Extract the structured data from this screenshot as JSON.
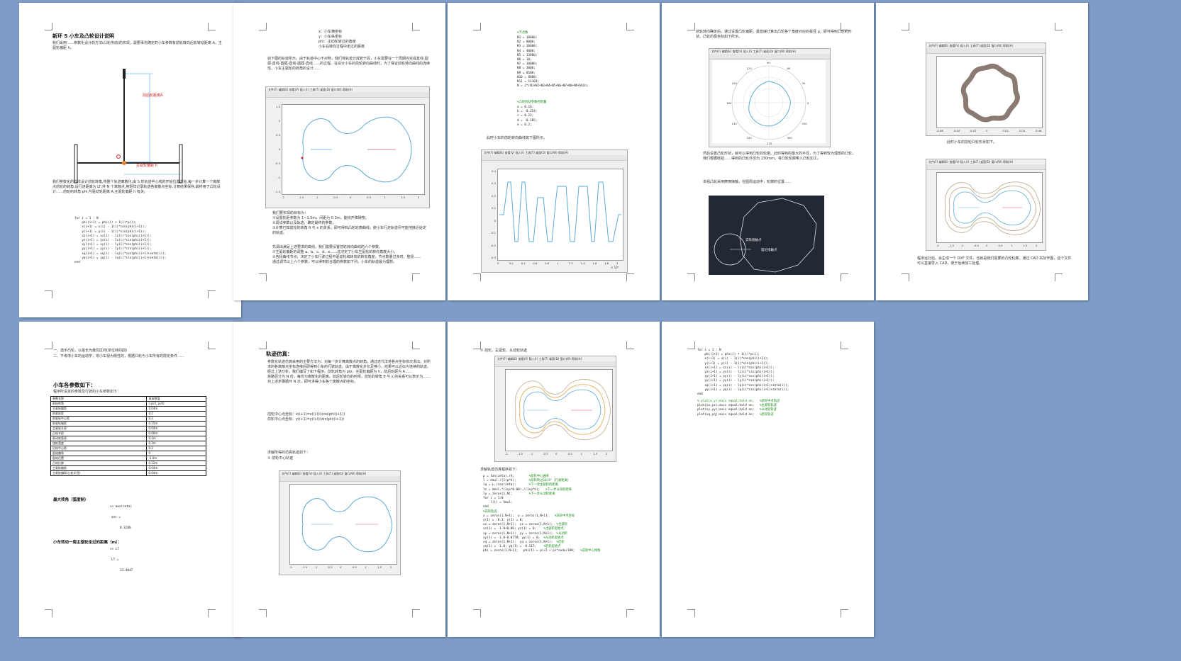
{
  "colors": {
    "background": "#7f9cc8",
    "curve": "#5aa9d6",
    "code_comment": "#1a8a1a"
  },
  "figure_menu": "文件(F)  编辑(E)  查看(V)  插入(I)  工具(T)  桌面(D)  窗口(W)  帮助(H)",
  "page1": {
    "title": "新环 S 小车及凸轮设计说明",
    "intro": "我们采用……参数化设计的方法(凸轮传动)的实现，需要事先确定的小车参数有前轮转向后轮转动距离 A，主驱轮偏距 h。",
    "label_a": "前后轮距离A",
    "label_h": "主驱轮偏距 h",
    "para": "我们参数化的方法设计前轮转角,将整个轨迹离散化,由 S 形轨迹中心线的开始位置开始,每一步计算一个离散点前轮的转角,设行进距离为 LT,共 N 个离散点,用矩阵记录轨迹各离散点坐标,计算结果保存,最终用于凸轮设计……前轮的转角 phi,与驱动轮距离 A,主驱轮偏距 h 有关。",
    "code": [
      "for i = 1 : N",
      "    phi(i+1) = phi(i) + 1(i)*p(i);",
      "    x(i+1) = x(i) - 1(i)*cos(phi(i+1));",
      "    y(i+1) = y(i) - 1(i)*sin(phi(i+1));",
      "    xz(i+1) = xz(i) - lz(i)*cos(phi(i+1));",
      "    yz(i+1) = yz(i) - lz(i)*sin(phi(i+1));",
      "    xy(i+1) = xy(i) - ly(i)*cos(phi(i+1));",
      "    yy(i+1) = yy(i) - ly(i)*sin(phi(i+1));",
      "    xq(i+1) = xq(i) - lq(i)*cos(phi(i+1)+zeta(i));",
      "    yq(i+1) = yq(i) - lq(i)*sin(phi(i+1)+zeta(i));",
      "end"
    ]
  },
  "page2": {
    "list": [
      "x：小车横坐标",
      "y：小车纵坐标",
      "phi：主动轮转过的角度",
      "小车在转向过程中走过的距离"
    ],
    "para1": "如下图的轨迹所示，由于轨迹中心不对称，我们将轨迹分成若干段，小车需要在一个周期内完成直线-圆弧-直线-圆弧-直线-圆弧-直线……的过程。在设计小车的前轮转向曲线时，为了保证前轮转向曲线的连续性，小车主驱轮的转角的设计……",
    "tick_x": [
      "-2",
      "-1.5",
      "-1",
      "-0.5",
      "0",
      "0.5",
      "1",
      "1.5",
      "2"
    ],
    "tick_y": [
      "1.5",
      "1",
      "0.5",
      "0",
      "-0.5",
      "-1",
      "-1.5"
    ],
    "steps": [
      "我们要实现的目标为：",
      "①设置轮距参数为 1~1.5m，间距为 0.3m，能绕开障碍物；",
      "②调试参数以及轨迹，确定最终的参数；",
      "③计算已知前轮的转角 θ 与 x 的关系，即可得到凸轮轮廓曲线，使小车行走轨迹尽可能地接近给定的轨迹。"
    ],
    "para2": "先调出满足上述要求的曲线，我们需要设置前轮转向曲线的六个参数。\n①主驱轮偏距的调整 a、b、c、d、e……这决定了小车主驱轮的转向角度大小。\n②各段曲线节点，决定了小车行驶过程中驱动轮和转向的转向角度，节点数量过多时，整段……\n通过调节以上六个参数，可以得到较合理的参数如下列。小车的轨迹最为理想。"
  },
  "page3": {
    "code_comment1": "%节点数",
    "code_nodes": [
      "N1 = 10000;",
      "N2 = 8000;",
      "N3 = 10000;",
      "N4 = 4000;",
      "N5 = 13000;",
      "N6 = 10;",
      "N7 = 10000;",
      "N8 = 3000;",
      "N9 = 8500;",
      "N10 = 8000;",
      "N11 = 11103;",
      "N = 2*(N1+N2+N3+N4+N5+N6+N7+N8+N9+N10);"
    ],
    "code_comment2": "%凸轮形状参数控制量",
    "code_params": [
      "a = 0.16;",
      "b = -0.254;",
      "c = 0.22;",
      "d = -0.185;",
      "e = 0.2;"
    ],
    "caption": "此时小车的前轮转向曲线如下图所示。",
    "tick_y": [
      "0.4",
      "0.3",
      "0.2",
      "0.1",
      "0",
      "-0.1",
      "-0.2",
      "-0.3"
    ],
    "tick_x": [
      "0",
      "0.2",
      "0.4",
      "0.6",
      "0.8",
      "1",
      "1.2",
      "1.4",
      "1.6",
      "1.8",
      "2"
    ],
    "exp": "× 10⁵"
  },
  "page4": {
    "para1": "前轮转向确定后，通过设置凸轮偏距，最直接计算出凸轮各个角度对应的极径 ρ，即可得到凸轮的形状。凸轮的极坐标如下所示。",
    "polar_labels": [
      "90",
      "60",
      "30",
      "0",
      "330",
      "300",
      "270",
      "240",
      "210",
      "180",
      "150",
      "120"
    ],
    "para2": "然后设置凸轮形状，就可以得到凸轮的轮廓。此时得到的最大的半径，为了得到较为理想的凸轮，我们根据经验……得到的凸轮外径为 130mm，将凸轮轮廓带入凸轮加工。",
    "para3": "本组凸轮采用摩擦接触，在圆周运动中，轮廓的位置……",
    "cad_labels": [
      "实际接触点",
      "理论接触点"
    ]
  },
  "page5": {
    "ticks_top": [
      "-0.06",
      "-0.04",
      "-0.02",
      "0",
      "0.02",
      "0.04",
      "0.06"
    ],
    "caption1": "此时小车的前轮凸轮形状如下。",
    "tick_x": [
      "-2",
      "-1.5",
      "-1",
      "-0.5",
      "0",
      "0.5",
      "1",
      "1.5",
      "2"
    ],
    "para": "程序运行后，会生成一个 DXF 文件，也就是我们需要的凸轮轮廓。通过 CAD 实际作图，这个文件可以直接导入 CAD，便于后续加工处理。"
  },
  "page6": {
    "list": [
      "一、选手凸轮，以最长为最优区间(单位转的回)",
      "二、不考虑小车的运动学，将小车视为刚性的，根据凸轮与小车所有的限定条件……"
    ],
    "heading": "小车各参数如下：",
    "table_caption": "程序所设定的参数及行驶的小车参数如下：",
    "table": [
      [
        "参数名称",
        "具体数值"
      ],
      [
        "前轮转角",
        "(-pi/4, pi/4)"
      ],
      [
        "主驱轮偏距",
        "0.04m"
      ],
      [
        "前驱轮距",
        "0.1"
      ],
      [
        "前驱轮中心距",
        "0.2"
      ],
      [
        "前驱轮轴距",
        "0.15m"
      ],
      [
        "主驱轮半径",
        "0.04m"
      ],
      [
        "凸轮半径",
        "0.06m"
      ],
      [
        "驱动轮直径",
        "0.1m"
      ],
      [
        "绕桩宽度",
        "0.3m"
      ],
      [
        "后轮中心距",
        "0.2"
      ],
      [
        "起始偏角",
        "0"
      ],
      [
        "起始位置",
        "-1.0m"
      ],
      [
        "凸轮位移",
        "0.12m"
      ],
      [
        "主驱轮偏距",
        "0.04m"
      ],
      [
        "主驱轮偏距(凸轮半径)",
        "0.04m"
      ]
    ],
    "h2": "最大转角（弧度制）",
    "c1": ">> max(zeta)",
    "c2": "ans =",
    "c3": "0.3280",
    "h3": "小车转动一周主驱轮走过的距离（m）：",
    "c4": ">> LT",
    "c5": "LT =",
    "c6": "33.4047"
  },
  "page7": {
    "heading": "轨迹仿真：",
    "para": "参数化轨迹仿真采用的主要方法为：对每一步计算离散点的转角，通过迭代法将各点坐标依次求出，对所求的各离散点坐标连接后即得到小车的行驶轨迹。由于离散化步长足够小，结果可以近似为连续的轨迹。\n经过上述分析，我们编写了如下程序。前轮转角为 phi，主驱轮偏距为 h，前后轮距为 A……\n将路径分为 N 份，每份为离散化的距离。前后轮转向的时候，前轮的转角 θ 与 x 的关系可以表示为……\n对上述步骤循环 N 次，即可求得小车各个离散点的坐标。",
    "formula": "前轮中心点坐标：x(i+1)=x(i)-l(i)cos(phi(i+1))\n前轮中心点坐标：y(i+1)=y(i)-l(i)sin(phi(i+1))",
    "caption": "求解所得的仿真轨迹如下：",
    "item": "① 前轮中心轨迹",
    "tick_x": [
      "-2",
      "-1.5",
      "-1",
      "-0.5",
      "0",
      "0.5",
      "1",
      "1.5",
      "2"
    ]
  },
  "page8": {
    "item": "② 前轮、主驱轮、从动轮轨迹",
    "tick_x": [
      "-2",
      "-1.5",
      "-1",
      "-0.5",
      "0",
      "0.5",
      "1",
      "1.5",
      "2"
    ],
    "caption": "求解轨迹仿真程序如下：",
    "code": [
      "p = tan(zeta)./A;        %前轮中心曲率",
      "l = hmul./(1+p*h);       %前轮转过10/8°（行驶距离）",
      "lq = L./cos(zeta);       %下一步主驱轮的距离",
      "lz = hmul.*(1+p*0.08)./(1+p*h);   %下一步从动轮距离",
      "ly = zeros(1,N);         %下一步从动轮距离",
      "for i = 1:N",
      "    l(i) = hmul;",
      "end",
      "",
      "%前轮轨迹",
      "x = zeros(1,N+1);  y = zeros(1,N+1);   %前轮中点坐标",
      "y(1) = -0.3; y(1) = 0;",
      "xz = zeros(1,N+1);  yz = zeros(1,N+1);  %主驱轮",
      "xz(1) = -1.0+0.06; yz(1) = 0;    %主驱轮起始点",
      "xy = zeros(1,N+1);  yy = zeros(1,N+1);  %从动轮",
      "xy(1) = -1.0-0.0778; yy(1) = 0;  %从动轮起始点",
      "xq = zeros(1,N+1);  yq = zeros(1,N+1);  %后轮",
      "xq(1) = -1.0; yq(1) = -0.117;    %后轮起始点",
      "",
      "phi = zeros(1,N+1);   phi(1) = pi/2 + pi*sudu/180;   %前轮中心倾角"
    ]
  },
  "page9": {
    "code": [
      "for i = 1 : N",
      "    phi(i+1) = phi(i) + 1(i)*p(i);",
      "    x(i+1) = x(i) - 1(i)*cos(phi(i+1));",
      "    y(i+1) = y(i) - 1(i)*sin(phi(i+1));",
      "    xz(i+1) = xz(i) - lz(i)*cos(phi(i+1));",
      "    yz(i+1) = yz(i) - lz(i)*sin(phi(i+1));",
      "    xy(i+1) = xy(i) - ly(i)*cos(phi(i+1));",
      "    yy(i+1) = yy(i) - ly(i)*sin(phi(i+1));",
      "    xq(i+1) = xq(i) - lq(i)*cos(phi(i+1)+zeta(i));",
      "    yq(i+1) = yq(i) - lq(i)*sin(phi(i+1)+zeta(i));",
      "end"
    ],
    "plot_code": [
      "% plot(x,y);axis equal;hold on;   %前轮中点轨迹",
      "plot(xz,yz);axis equal;hold on;   %主驱轮轨迹",
      "plot(xy,yy);axis equal;hold on;   %从动轮轨迹",
      "plot(xq,yq);axis equal;hold on;   %后轮轨迹"
    ]
  }
}
